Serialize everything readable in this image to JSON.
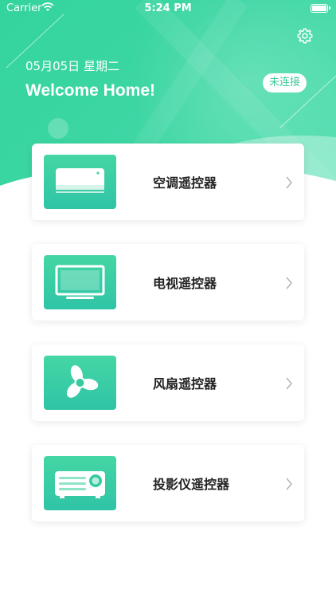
{
  "status_bar": {
    "carrier": "Carrier",
    "time": "5:24 PM"
  },
  "header": {
    "date": "05月05日  星期二",
    "welcome": "Welcome Home!",
    "connection_status": "未连接"
  },
  "devices": [
    {
      "label": "空调遥控器",
      "icon": "air-conditioner-icon"
    },
    {
      "label": "电视遥控器",
      "icon": "tv-icon"
    },
    {
      "label": "风扇遥控器",
      "icon": "fan-icon"
    },
    {
      "label": "投影仪遥控器",
      "icon": "projector-icon"
    }
  ],
  "colors": {
    "accent": "#3cd6a3",
    "accent_dark": "#2fc4a6",
    "text": "#222222"
  }
}
